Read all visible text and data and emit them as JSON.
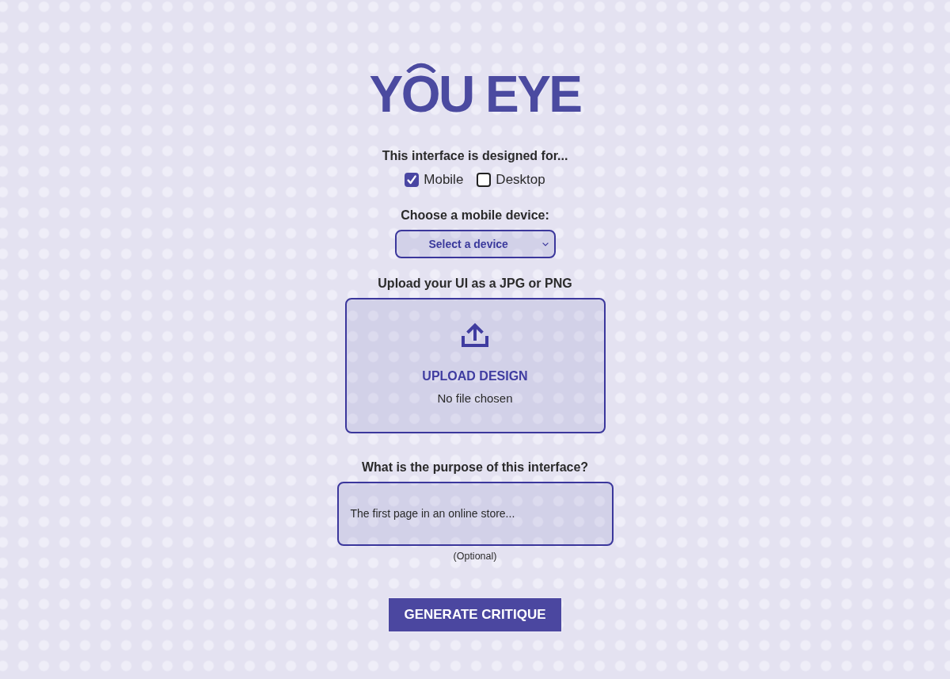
{
  "logo": {
    "text": "YOU EYE"
  },
  "platform": {
    "label": "This interface is designed for...",
    "options": [
      {
        "label": "Mobile",
        "checked": true
      },
      {
        "label": "Desktop",
        "checked": false
      }
    ]
  },
  "device": {
    "label": "Choose a mobile device:",
    "select": {
      "value": "Select a device"
    }
  },
  "upload": {
    "label": "Upload your UI as a JPG or PNG",
    "button": "UPLOAD DESIGN",
    "status": "No file chosen"
  },
  "purpose": {
    "label": "What is the purpose of this interface?",
    "placeholder": "The first page in an online store...",
    "note": "(Optional)"
  },
  "submit": {
    "label": "GENERATE CRITIQUE"
  }
}
